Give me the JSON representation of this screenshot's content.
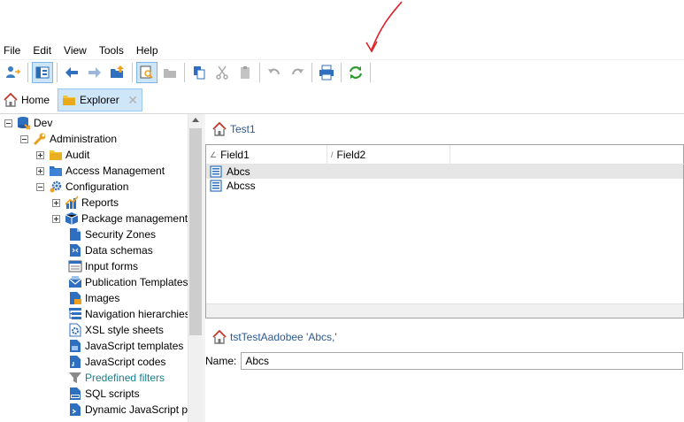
{
  "menu": [
    "File",
    "Edit",
    "View",
    "Tools",
    "Help"
  ],
  "tabs": {
    "home": "Home",
    "explorer": "Explorer",
    "close_glyph": "✕"
  },
  "tree": {
    "items": [
      {
        "label": "Dev",
        "icon": "database-icon"
      },
      {
        "label": "Administration",
        "icon": "wrench-icon"
      },
      {
        "label": "Audit",
        "icon": "folder-icon"
      },
      {
        "label": "Access Management",
        "icon": "folder-icon"
      },
      {
        "label": "Configuration",
        "icon": "gear-icon"
      },
      {
        "label": "Reports",
        "icon": "chart-icon"
      },
      {
        "label": "Package management",
        "icon": "package-icon"
      },
      {
        "label": "Security Zones",
        "icon": "document-icon"
      },
      {
        "label": "Data schemas",
        "icon": "schema-icon"
      },
      {
        "label": "Input forms",
        "icon": "form-icon"
      },
      {
        "label": "Publication Templates",
        "icon": "mail-template-icon"
      },
      {
        "label": "Images",
        "icon": "image-icon"
      },
      {
        "label": "Navigation hierarchies",
        "icon": "hierarchy-icon"
      },
      {
        "label": "XSL style sheets",
        "icon": "xsl-icon"
      },
      {
        "label": "JavaScript templates",
        "icon": "js-template-icon"
      },
      {
        "label": "JavaScript codes",
        "icon": "js-code-icon"
      },
      {
        "label": "Predefined filters",
        "icon": "filter-icon"
      },
      {
        "label": "SQL scripts",
        "icon": "sql-icon"
      },
      {
        "label": "Dynamic JavaScript pa",
        "icon": "dynamic-js-icon"
      }
    ]
  },
  "main": {
    "folder_title": "Test1",
    "columns": [
      "Field1",
      "Field2"
    ],
    "sort_glyph": "∠",
    "rows": [
      "Abcs",
      "Abcss"
    ],
    "detail_title": "tstTestAadobee 'Abcs,'",
    "name_label": "Name:",
    "name_value": "Abcs"
  },
  "colors": {
    "accent_blue": "#2d5a92",
    "refresh_green": "#2e9a2e",
    "annotation_red": "#e0202a",
    "folder_yellow": "#f2c437",
    "tab_selected": "#cfe5f8"
  }
}
